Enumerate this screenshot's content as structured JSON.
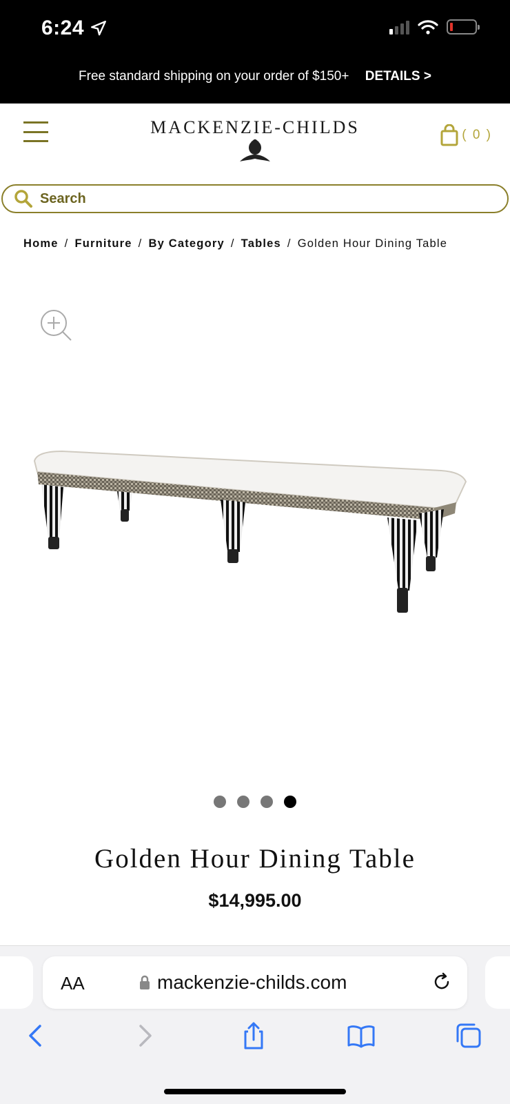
{
  "status_bar": {
    "time": "6:24"
  },
  "promo": {
    "text": "Free standard shipping on your order of $150+",
    "details_label": "DETAILS >"
  },
  "header": {
    "logo": "MACKENZIE-CHILDS",
    "cart_count": "( 0 )"
  },
  "search": {
    "placeholder": "Search"
  },
  "breadcrumb": {
    "items": [
      "Home",
      "Furniture",
      "By Category",
      "Tables"
    ],
    "separator": "/",
    "current": "Golden Hour Dining Table"
  },
  "gallery": {
    "slide_count": 4,
    "active_index": 3
  },
  "product": {
    "title": "Golden Hour Dining Table",
    "price": "$14,995.00"
  },
  "browser": {
    "text_size_label": "AA",
    "url": "mackenzie-childs.com"
  },
  "colors": {
    "brand_olive": "#7a7425",
    "cart_gold": "#b3a53a",
    "safari_blue": "#3478f6"
  }
}
